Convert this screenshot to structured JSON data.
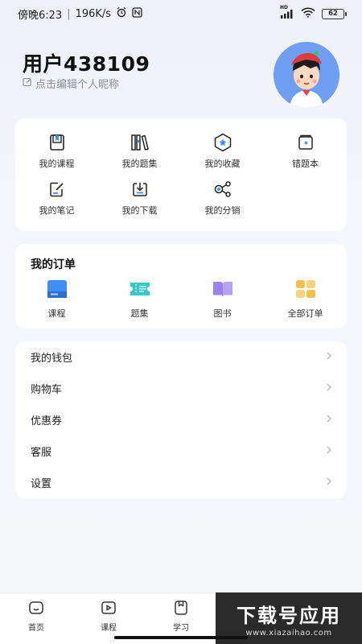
{
  "status_bar": {
    "time": "傍晚6:23",
    "net_speed": "196K/s",
    "network": "HD",
    "battery": "62"
  },
  "profile": {
    "username": "用户438109",
    "edit_hint": "点击编辑个人昵称"
  },
  "my_section": {
    "items": [
      {
        "label": "我的课程",
        "icon": "course-icon"
      },
      {
        "label": "我的题集",
        "icon": "books-icon"
      },
      {
        "label": "我的收藏",
        "icon": "star-icon"
      },
      {
        "label": "错题本",
        "icon": "wrong-book-icon"
      },
      {
        "label": "我的笔记",
        "icon": "note-icon"
      },
      {
        "label": "我的下载",
        "icon": "download-icon"
      },
      {
        "label": "我的分销",
        "icon": "share-icon"
      }
    ]
  },
  "orders": {
    "title": "我的订单",
    "items": [
      {
        "label": "课程",
        "icon": "course-order-icon",
        "color": "#3d8ff5"
      },
      {
        "label": "题集",
        "icon": "ticket-icon",
        "color": "#3cc7c7"
      },
      {
        "label": "图书",
        "icon": "book-icon",
        "color": "#9b82ee"
      },
      {
        "label": "全部订单",
        "icon": "grid-icon",
        "color": "#f2c14e"
      }
    ]
  },
  "menu": {
    "items": [
      {
        "label": "我的钱包"
      },
      {
        "label": "购物车"
      },
      {
        "label": "优惠券"
      },
      {
        "label": "客服"
      },
      {
        "label": "设置"
      }
    ]
  },
  "bottom_nav": {
    "items": [
      {
        "label": "首页",
        "icon": "home-icon"
      },
      {
        "label": "课程",
        "icon": "play-icon"
      },
      {
        "label": "学习",
        "icon": "study-icon"
      }
    ]
  },
  "watermark": {
    "title": "下载号应用",
    "url": "www.xiazaihao.com"
  }
}
